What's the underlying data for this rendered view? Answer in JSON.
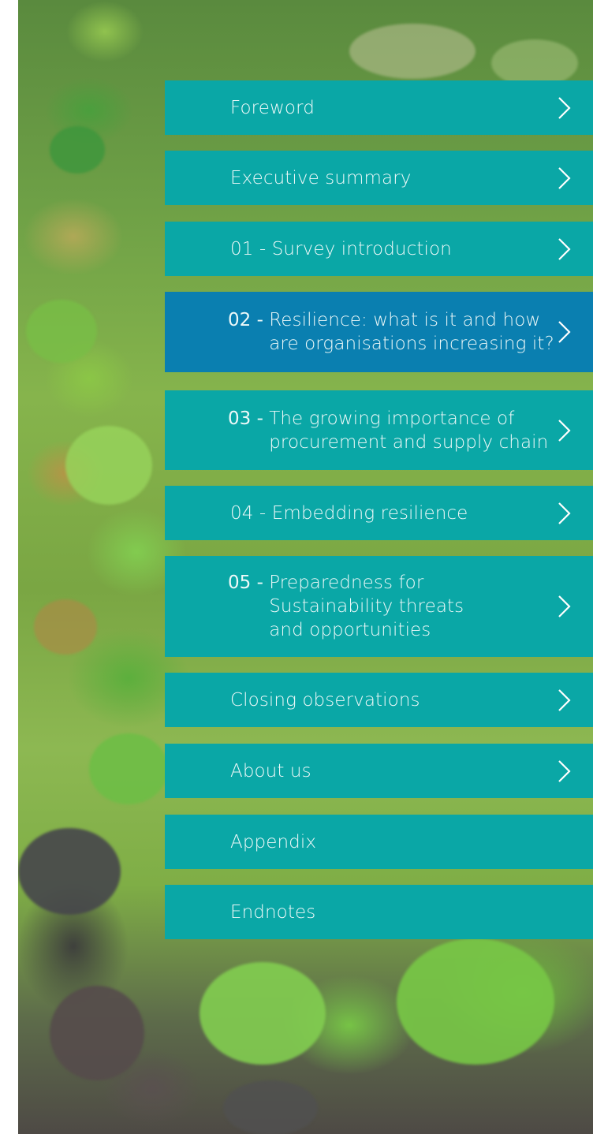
{
  "menu": {
    "items": [
      {
        "label": "Foreword",
        "chevron": true
      },
      {
        "label": "Executive summary",
        "chevron": true
      },
      {
        "label": "01 - Survey introduction",
        "chevron": true
      },
      {
        "number": "02 - ",
        "lines": [
          "Resilience: what is it and how",
          "are organisations increasing it?"
        ],
        "chevron": true,
        "active": true
      },
      {
        "number": "03 - ",
        "lines": [
          "The growing importance of",
          "procurement and supply chain"
        ],
        "chevron": true
      },
      {
        "label": "04 - Embedding resilience",
        "chevron": true
      },
      {
        "number": "05 - ",
        "lines": [
          "Preparedness for",
          "Sustainability threats",
          "and opportunities"
        ],
        "chevron": true
      },
      {
        "label": "Closing observations",
        "chevron": true
      },
      {
        "label": "About us",
        "chevron": true
      },
      {
        "label": "Appendix",
        "chevron": false
      },
      {
        "label": "Endnotes",
        "chevron": false
      }
    ]
  },
  "colors": {
    "item_background": "#0aa7a6",
    "active_background": "#0a7fb0",
    "text": "#ffffff"
  },
  "icons": {
    "chevron": "chevron-right-icon",
    "background": "succulent-plants-photo"
  }
}
